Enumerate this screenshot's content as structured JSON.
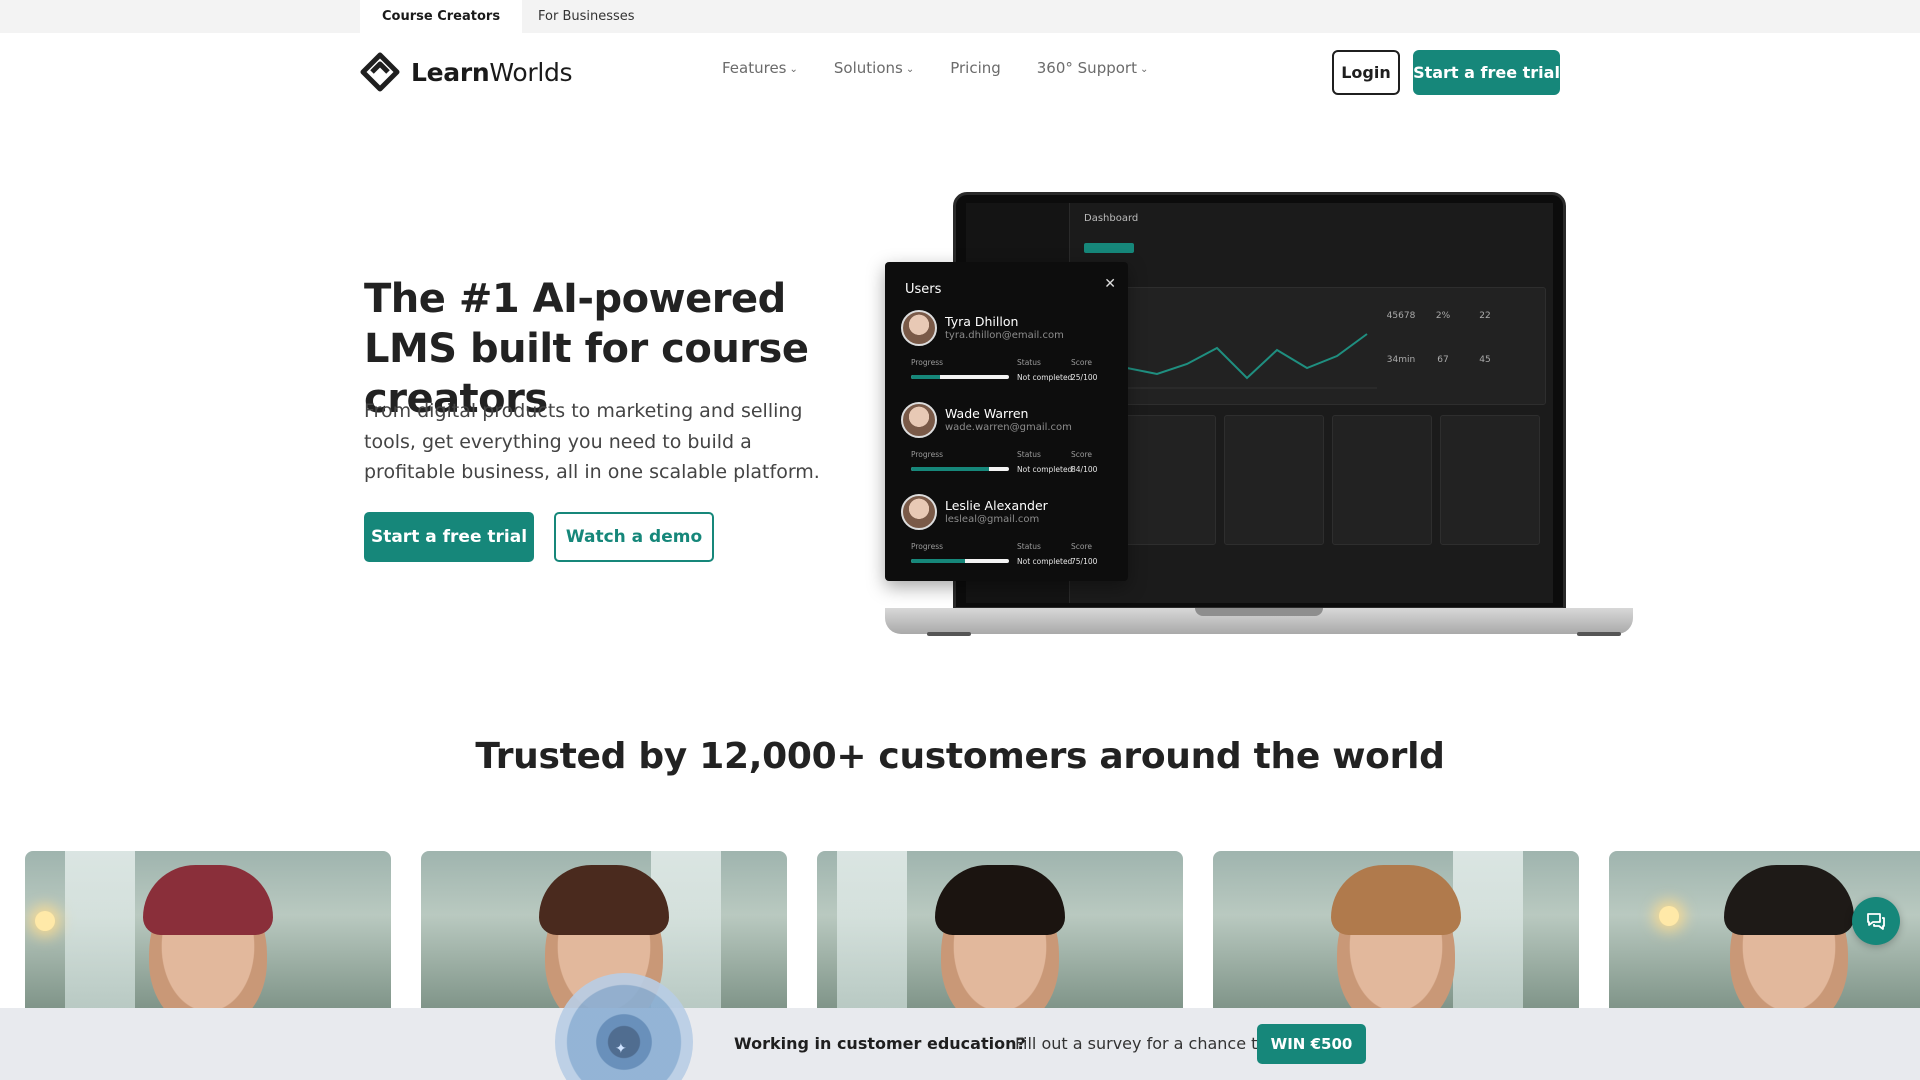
{
  "audience_tabs": [
    {
      "label": "Course Creators",
      "active": true
    },
    {
      "label": "For Businesses",
      "active": false
    }
  ],
  "logo": {
    "text_bold": "Learn",
    "text_regular": "Worlds"
  },
  "nav": [
    {
      "label": "Features",
      "dropdown": true
    },
    {
      "label": "Solutions",
      "dropdown": true
    },
    {
      "label": "Pricing",
      "dropdown": false
    },
    {
      "label": "360° Support",
      "dropdown": true
    }
  ],
  "header": {
    "login_label": "Login",
    "trial_label": "Start a free trial"
  },
  "hero": {
    "title": "The #1 AI-powered LMS built for course creators",
    "subtitle": "From digital products to marketing and selling tools, get everything you need to build a profitable business, all in one scalable platform.",
    "cta_primary": "Start a free trial",
    "cta_secondary": "Watch a demo"
  },
  "users_card": {
    "title": "Users",
    "col_progress": "Progress",
    "col_status": "Status",
    "col_score": "Score",
    "users": [
      {
        "name": "Tyra Dhillon",
        "email": "tyra.dhillon@email.com",
        "progress": 0.3,
        "status": "Not completed",
        "score": "25/100"
      },
      {
        "name": "Wade Warren",
        "email": "wade.warren@gmail.com",
        "progress": 0.8,
        "status": "Not completed",
        "score": "84/100"
      },
      {
        "name": "Leslie Alexander",
        "email": "lesleal@gmail.com",
        "progress": 0.55,
        "status": "Not completed",
        "score": "75/100"
      }
    ]
  },
  "dashboard": {
    "title": "Dashboard",
    "stats": [
      "45678",
      "2%",
      "22",
      "34min",
      "67",
      "45"
    ]
  },
  "trusted": {
    "heading": "Trusted by 12,000+ customers around the world"
  },
  "banner": {
    "question": "Working in customer education?",
    "text": "Fill out a survey for a chance to",
    "button": "WIN €500"
  },
  "colors": {
    "accent": "#16877a",
    "dark": "#1f1f1f",
    "banner_bg": "#e8eaee"
  },
  "icons": [
    "logo-mark-icon",
    "chevron-down-icon",
    "close-icon",
    "chat-icon",
    "sparkle-icon"
  ]
}
